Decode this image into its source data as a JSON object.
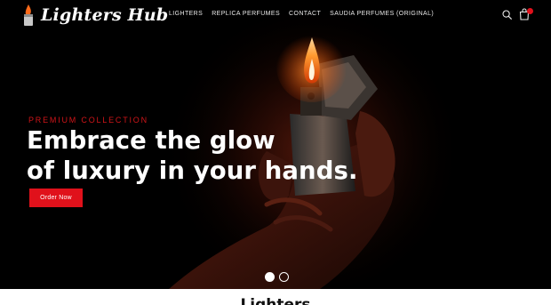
{
  "header": {
    "logo_text": "Lighters Hub",
    "nav": [
      "LIGHTERS",
      "REPLICA PERFUMES",
      "CONTACT",
      "SAUDIA PERFUMES (ORIGINAL)"
    ],
    "icons": {
      "search": "search-icon",
      "cart": "shopping-bag-icon"
    }
  },
  "hero": {
    "kicker": "PREMIUM COLLECTION",
    "headline_line1": "Embrace the glow",
    "headline_line2": "of luxury in your hands.",
    "cta_label": "Order Now",
    "slides": {
      "count": 2,
      "active": 1
    }
  },
  "section": {
    "title": "Lighters"
  },
  "colors": {
    "accent": "#e0111b",
    "hero_background": "#000000",
    "text_light": "#ffffff",
    "flame": "#ff8a2a"
  }
}
